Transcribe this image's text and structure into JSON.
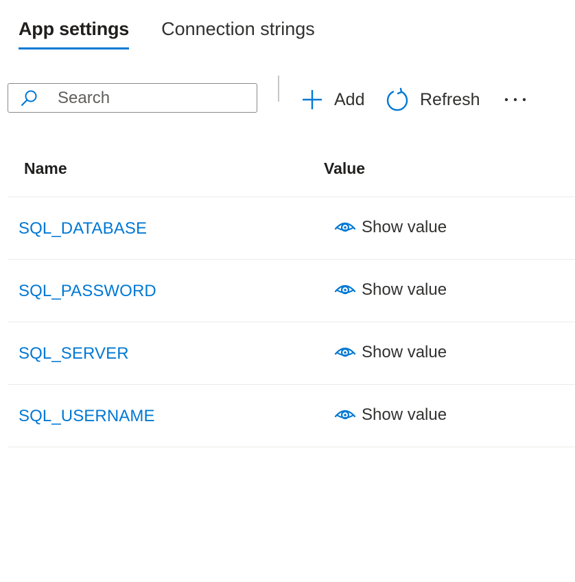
{
  "tabs": [
    {
      "label": "App settings",
      "active": true
    },
    {
      "label": "Connection strings",
      "active": false
    }
  ],
  "toolbar": {
    "search_placeholder": "Search",
    "search_value": "",
    "add_label": "Add",
    "refresh_label": "Refresh",
    "more_label": "···",
    "icons": {
      "search": "search-icon",
      "add": "plus-icon",
      "refresh": "refresh-icon",
      "more": "more-icon"
    }
  },
  "table": {
    "columns": [
      "Name",
      "Value"
    ],
    "rows": [
      {
        "name": "SQL_DATABASE",
        "value_label": "Show value"
      },
      {
        "name": "SQL_PASSWORD",
        "value_label": "Show value"
      },
      {
        "name": "SQL_SERVER",
        "value_label": "Show value"
      },
      {
        "name": "SQL_USERNAME",
        "value_label": "Show value"
      }
    ],
    "value_icon": "eye-icon"
  },
  "colors": {
    "accent": "#0078d4",
    "text": "#323130",
    "divider": "#edebe9"
  }
}
